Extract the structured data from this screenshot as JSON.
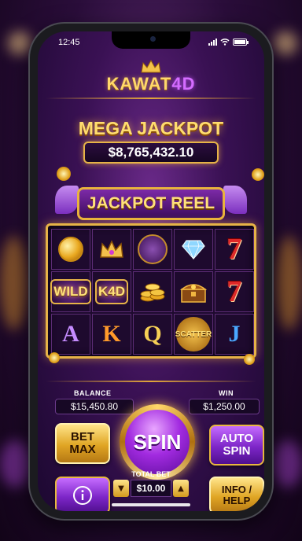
{
  "status_bar": {
    "time": "12:45"
  },
  "brand": {
    "name": "KAWAT",
    "accent": "4D"
  },
  "jackpot": {
    "title": "MEGA JACKPOT",
    "amount": "$8,765,432.10"
  },
  "reel": {
    "banner": "JACKPOT REEL",
    "rows": [
      [
        "coin-icon",
        "crown-icon",
        "dragon-icon",
        "diamond-icon",
        "seven"
      ],
      [
        "wild",
        "k4d",
        "coin-stack-icon",
        "treasure-chest-icon",
        "seven"
      ],
      [
        "A",
        "K",
        "Q",
        "scatter",
        "J"
      ]
    ],
    "labels": {
      "wild": "WILD",
      "k4d": "K4D",
      "seven": "7",
      "scatter": "SCATTER",
      "A": "A",
      "K": "K",
      "Q": "Q",
      "J": "J"
    }
  },
  "stats": {
    "balance_label": "BALANCE",
    "balance_value": "$15,450.80",
    "win_label": "WIN",
    "win_value": "$1,250.00"
  },
  "controls": {
    "bet_max_line1": "BET",
    "bet_max_line2": "MAX",
    "spin": "SPIN",
    "auto_spin_line1": "AUTO",
    "auto_spin_line2": "SPIN",
    "info_icon": "info-icon",
    "total_bet_label": "TOTAL BET",
    "total_bet_value": "$10.00",
    "info_help_line1": "INFO /",
    "info_help_line2": "HELP"
  },
  "colors": {
    "gold": "#e6b347",
    "purple": "#7d26c8",
    "seven_red": "#e02828"
  }
}
